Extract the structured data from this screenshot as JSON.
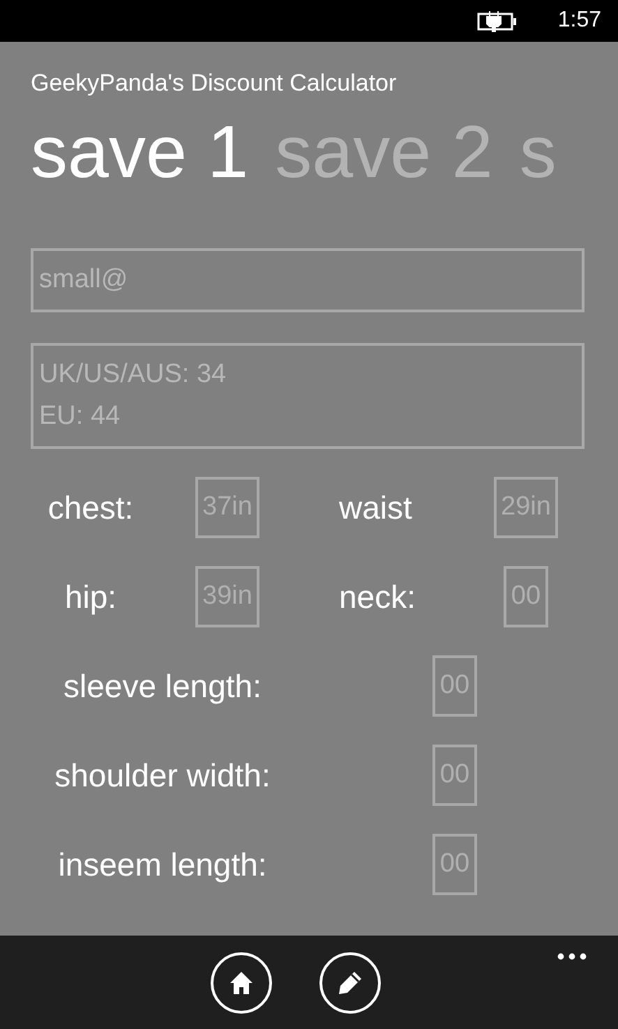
{
  "status_bar": {
    "time": "1:57",
    "charging": true
  },
  "app_title": "GeekyPanda's Discount Calculator",
  "tabs": [
    {
      "label": "save 1",
      "selected": true
    },
    {
      "label": "save 2",
      "selected": false
    },
    {
      "label": "s",
      "selected": false
    }
  ],
  "fields": [
    {
      "lines": [
        "small@"
      ]
    },
    {
      "lines": [
        "UK/US/AUS: 34",
        "EU: 44"
      ]
    }
  ],
  "measurement_rows": [
    {
      "kind": "pair",
      "items": [
        {
          "label": "chest:",
          "value": "37in"
        },
        {
          "label": "waist",
          "value": "29in"
        }
      ]
    },
    {
      "kind": "pair",
      "items": [
        {
          "label": "hip:",
          "value": "39in"
        },
        {
          "label": "neck:",
          "value": "00"
        }
      ]
    },
    {
      "kind": "single",
      "items": [
        {
          "label": "sleeve length:",
          "value": "00"
        }
      ]
    },
    {
      "kind": "single",
      "items": [
        {
          "label": "shoulder width:",
          "value": "00"
        }
      ]
    },
    {
      "kind": "single",
      "items": [
        {
          "label": "inseem length:",
          "value": "00"
        }
      ]
    }
  ],
  "app_bar": {
    "buttons": [
      {
        "kind": "home"
      },
      {
        "kind": "edit"
      }
    ],
    "more": true
  }
}
